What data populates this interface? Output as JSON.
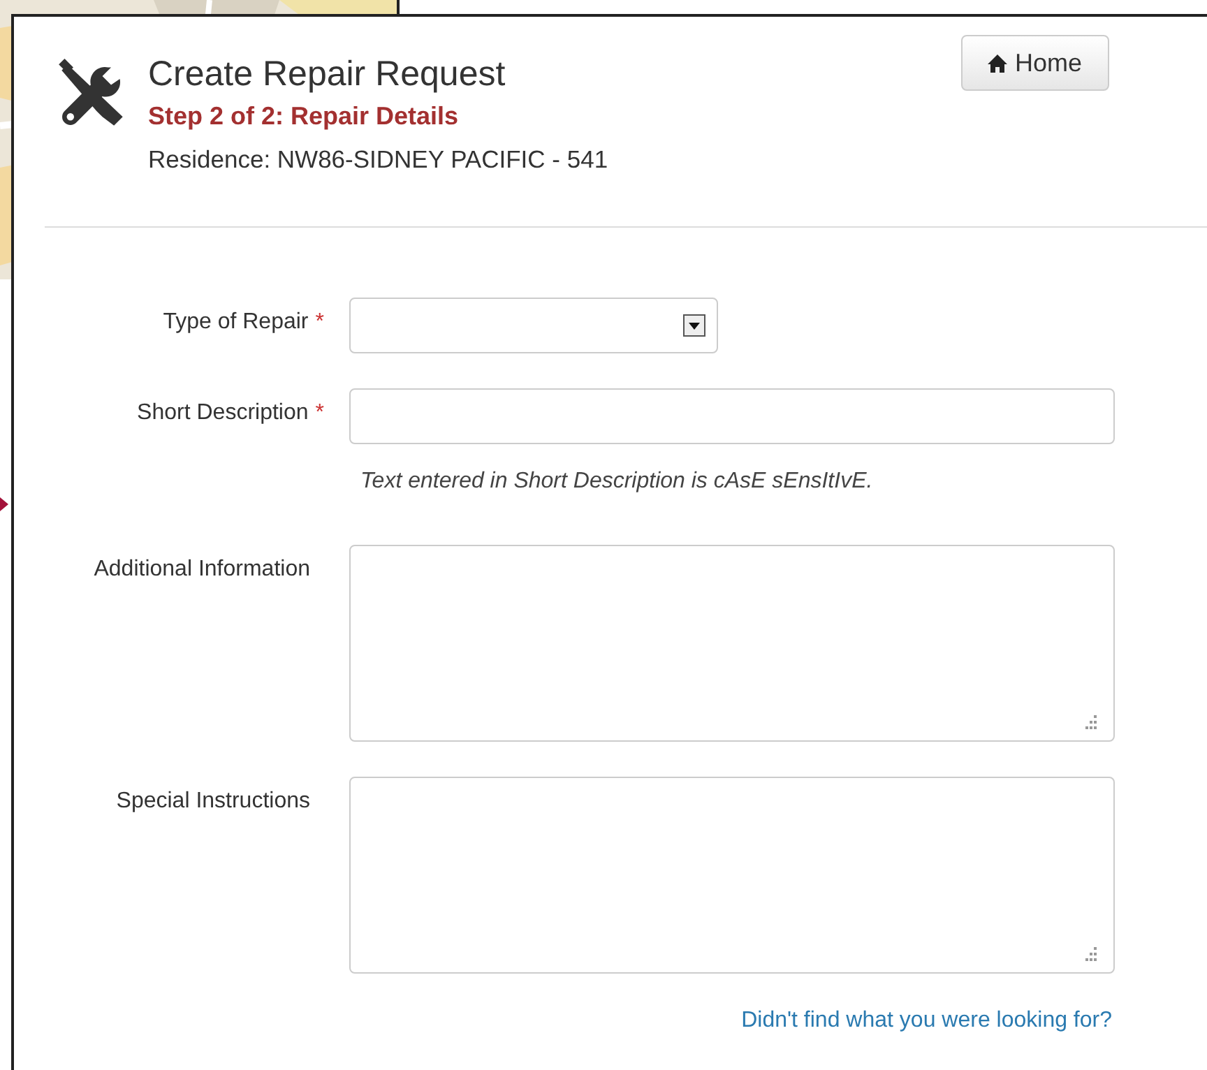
{
  "dialog": {
    "title": "Create Repair Request",
    "step": "Step 2 of 2: Repair Details",
    "residence": "Residence: NW86-SIDNEY PACIFIC - 541",
    "home_button": "Home",
    "fields": [
      {
        "kind": "select",
        "label": "Type of Repair",
        "required_mark": "*"
      },
      {
        "kind": "text",
        "label": "Short Description",
        "required_mark": "*",
        "hint": "Text entered in Short Description is cAsE sEnsItIvE."
      },
      {
        "kind": "textarea",
        "label": "Additional Information"
      },
      {
        "kind": "textarea",
        "label": "Special Instructions"
      }
    ],
    "help_link": "Didn't find what you were looking for?"
  }
}
